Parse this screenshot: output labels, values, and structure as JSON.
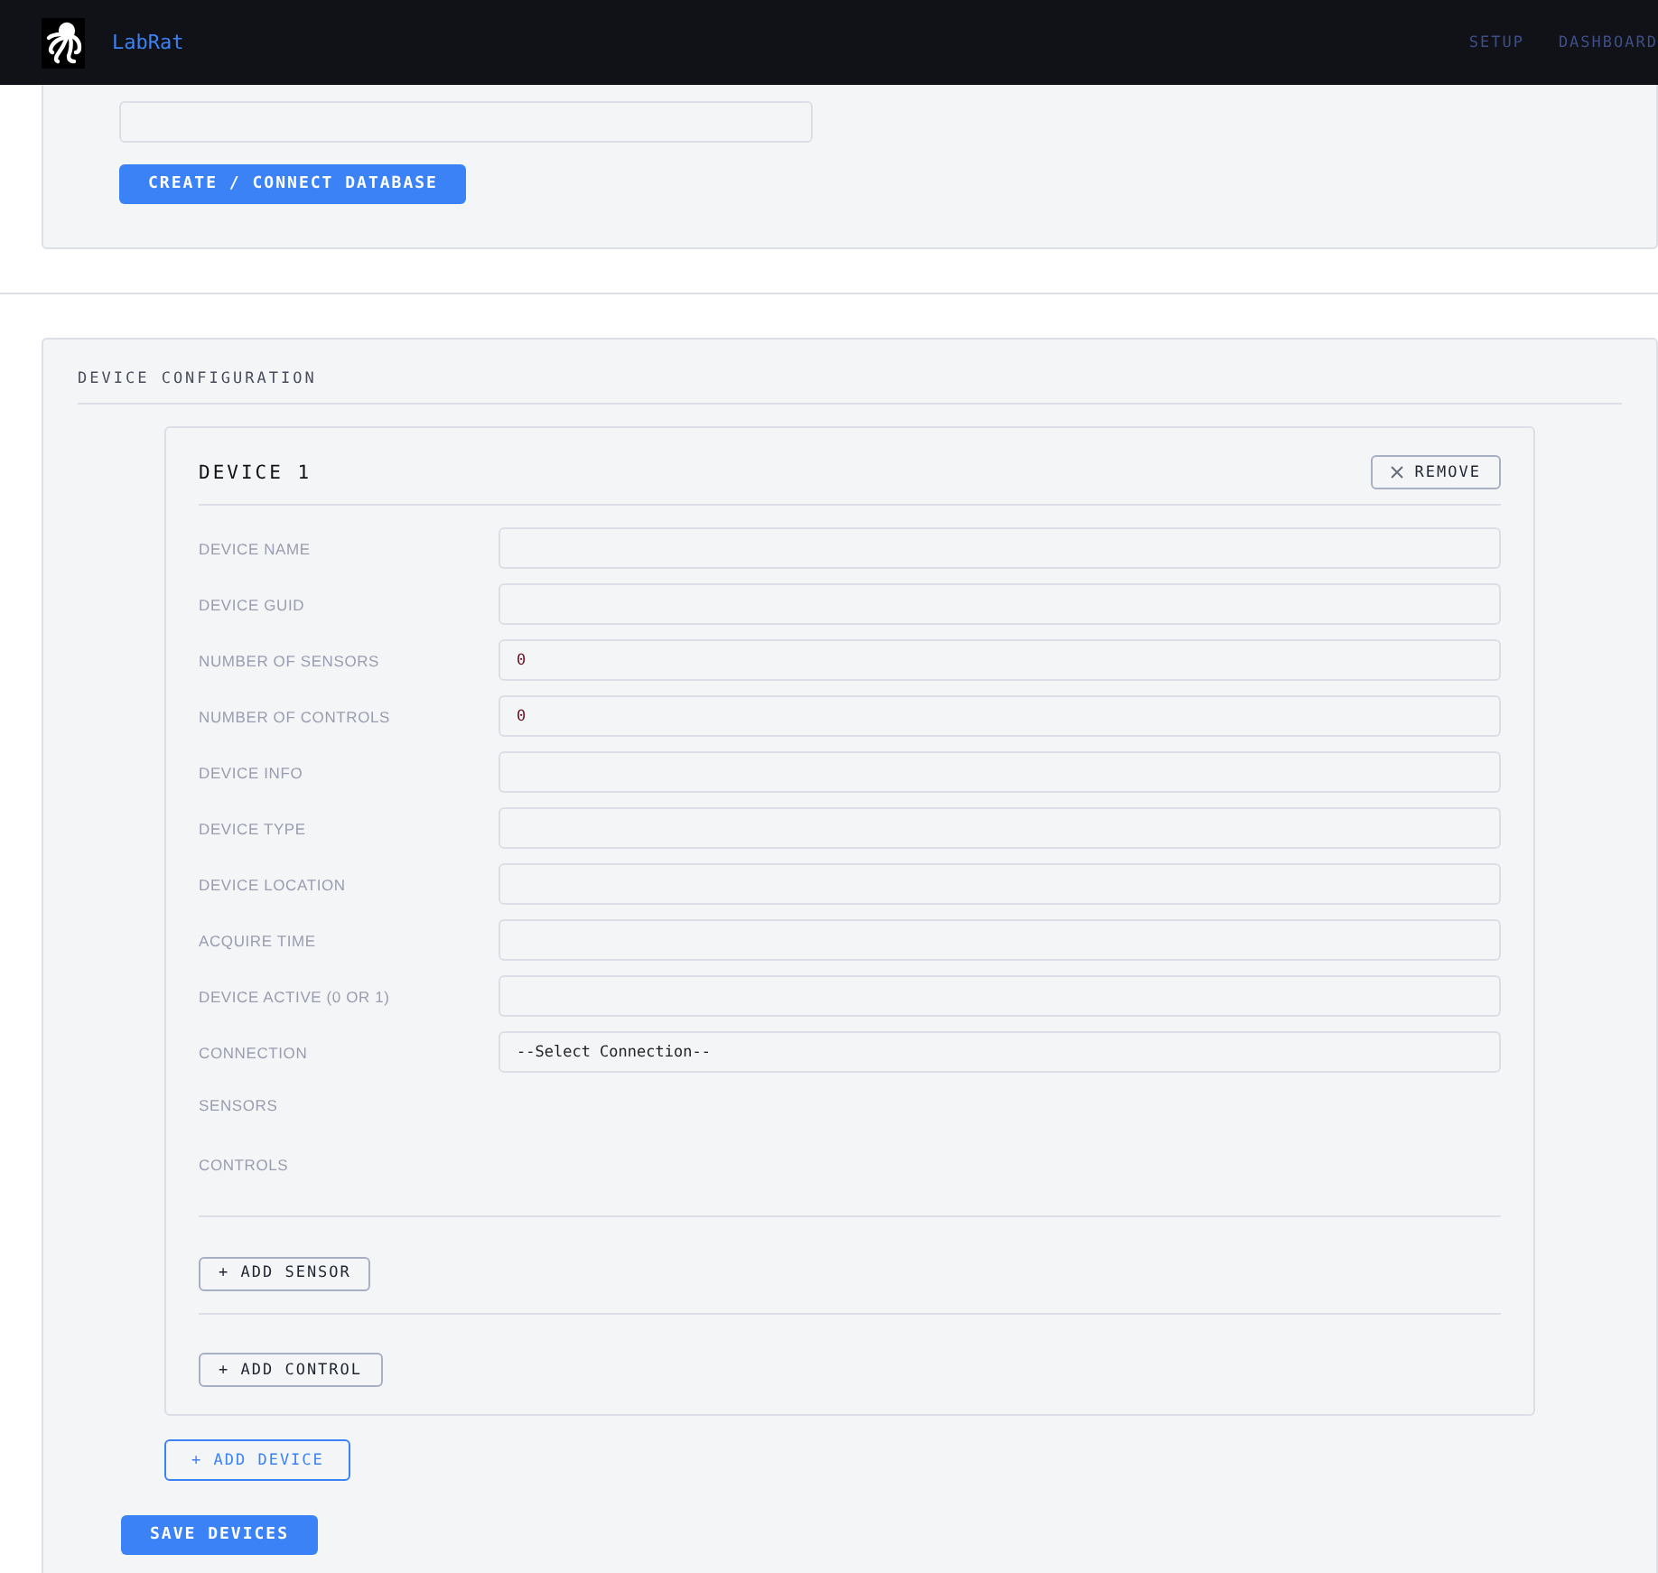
{
  "navbar": {
    "brand": "LabRat",
    "links": [
      {
        "label": "SETUP"
      },
      {
        "label": "DASHBOARD"
      }
    ]
  },
  "database": {
    "button": "CREATE / CONNECT DATABASE"
  },
  "device_configuration": {
    "title": "DEVICE CONFIGURATION",
    "devices": [
      {
        "title": "DEVICE 1",
        "remove_button": "REMOVE",
        "fields": [
          {
            "label": "DEVICE NAME",
            "kind": "input"
          },
          {
            "label": "DEVICE GUID",
            "kind": "input"
          },
          {
            "label": "NUMBER OF SENSORS",
            "kind": "input",
            "value": "0"
          },
          {
            "label": "NUMBER OF CONTROLS",
            "kind": "input",
            "value": "0"
          },
          {
            "label": "DEVICE INFO",
            "kind": "input"
          },
          {
            "label": "DEVICE TYPE",
            "kind": "input"
          },
          {
            "label": "DEVICE LOCATION",
            "kind": "input"
          },
          {
            "label": "ACQUIRE TIME",
            "kind": "input"
          },
          {
            "label": "DEVICE ACTIVE (0 OR 1)",
            "kind": "input"
          },
          {
            "label": "CONNECTION",
            "kind": "select",
            "value": "--Select Connection--"
          }
        ],
        "sections": [
          {
            "label": "SENSORS"
          },
          {
            "label": "CONTROLS"
          }
        ],
        "add_sensor_button": "+ ADD SENSOR",
        "add_control_button": "+ ADD CONTROL"
      }
    ],
    "add_device_button": "+ ADD DEVICE",
    "save_button": "SAVE DEVICES"
  }
}
